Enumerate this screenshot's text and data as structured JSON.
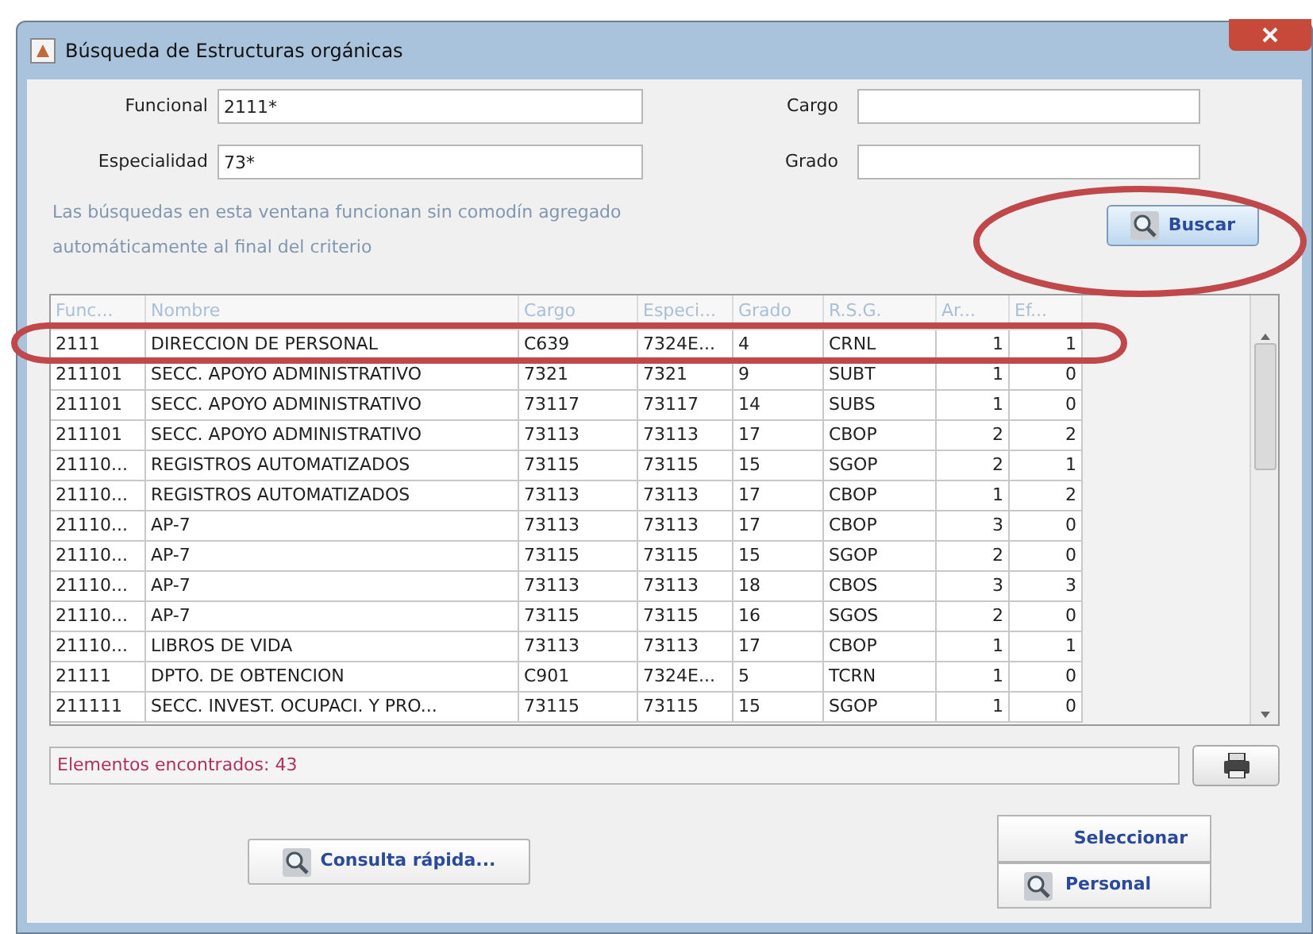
{
  "window": {
    "title": "Búsqueda de Estructuras orgánicas"
  },
  "fields": [
    {
      "label": "Funcional",
      "value": "2111*"
    },
    {
      "label": "Cargo"
    },
    {
      "label": "Especialidad",
      "value": "73*"
    },
    {
      "label": "Grado"
    }
  ],
  "hint": "Las búsquedas en esta ventana funcionan sin comodín agregado automáticamente al final del criterio",
  "search_button": "Buscar",
  "table": {
    "columns": [
      "Func...",
      "Nombre",
      "Cargo",
      "Especi...",
      "Grado",
      "R.S.G.",
      "Ar...",
      "Ef..."
    ],
    "rows": [
      [
        "2111",
        "DIRECCION DE PERSONAL",
        "C639",
        "7324E...",
        "4",
        "CRNL",
        "1",
        "1"
      ],
      [
        "211101",
        "SECC. APOYO ADMINISTRATIVO",
        "7321",
        "7321",
        "9",
        "SUBT",
        "1",
        "0"
      ],
      [
        "211101",
        "SECC. APOYO ADMINISTRATIVO",
        "73117",
        "73117",
        "14",
        "SUBS",
        "1",
        "0"
      ],
      [
        "211101",
        "SECC. APOYO ADMINISTRATIVO",
        "73113",
        "73113",
        "17",
        "CBOP",
        "2",
        "2"
      ],
      [
        "21110...",
        "REGISTROS AUTOMATIZADOS",
        "73115",
        "73115",
        "15",
        "SGOP",
        "2",
        "1"
      ],
      [
        "21110...",
        "REGISTROS AUTOMATIZADOS",
        "73113",
        "73113",
        "17",
        "CBOP",
        "1",
        "2"
      ],
      [
        "21110...",
        "AP-7",
        "73113",
        "73113",
        "17",
        "CBOP",
        "3",
        "0"
      ],
      [
        "21110...",
        "AP-7",
        "73115",
        "73115",
        "15",
        "SGOP",
        "2",
        "0"
      ],
      [
        "21110...",
        "AP-7",
        "73113",
        "73113",
        "18",
        "CBOS",
        "3",
        "3"
      ],
      [
        "21110...",
        "AP-7",
        "73115",
        "73115",
        "16",
        "SGOS",
        "2",
        "0"
      ],
      [
        "21110...",
        "LIBROS DE VIDA",
        "73113",
        "73113",
        "17",
        "CBOP",
        "1",
        "1"
      ],
      [
        "21111",
        "DPTO. DE OBTENCION",
        "C901",
        "7324E...",
        "5",
        "TCRN",
        "1",
        "0"
      ],
      [
        "211111",
        "SECC. INVEST. OCUPACI. Y PRO...",
        "73115",
        "73115",
        "15",
        "SGOP",
        "1",
        "0"
      ]
    ]
  },
  "status": "Elementos encontrados: 43",
  "buttons": [
    {
      "kind": "quick",
      "label": "Consulta rápida..."
    },
    {
      "kind": "select",
      "label": "Seleccionar"
    },
    {
      "kind": "personal",
      "label": "Personal"
    }
  ],
  "annotations": {
    "search_button_circled": true,
    "first_row_circled": true
  }
}
